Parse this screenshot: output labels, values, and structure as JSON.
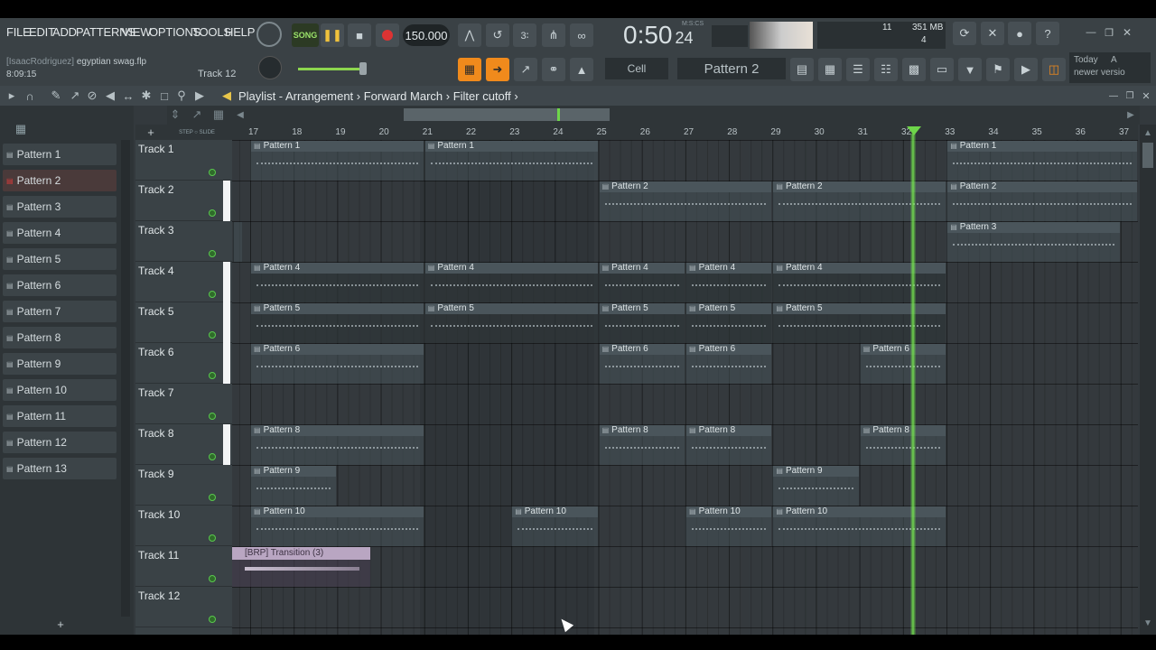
{
  "menu": [
    "FILE",
    "EDIT",
    "ADD",
    "PATTERNS",
    "VIEW",
    "OPTIONS",
    "TOOLS",
    "HELP"
  ],
  "project": {
    "user": "[IsaacRodriguez]",
    "file": "egyptian swag.flp",
    "time": "8:09:15",
    "track": "Track 12"
  },
  "transport": {
    "mode": "SONG",
    "tempo": "150.000",
    "time": "0:50",
    "time_small": "24",
    "time_label": "M:S:CS"
  },
  "cpu": {
    "value": "11",
    "memory": "351 MB",
    "voices": "4"
  },
  "snap": "Cell",
  "pattern_selector": "Pattern 2",
  "news": {
    "line1": "Today",
    "line2": "A",
    "line3": "newer versio"
  },
  "breadcrumb": {
    "view": "Playlist - Arrangement",
    "arrangement": "Forward March",
    "automation": "Filter cutoff"
  },
  "patterns": [
    "Pattern 1",
    "Pattern 2",
    "Pattern 3",
    "Pattern 4",
    "Pattern 5",
    "Pattern 6",
    "Pattern 7",
    "Pattern 8",
    "Pattern 9",
    "Pattern 10",
    "Pattern 11",
    "Pattern 12",
    "Pattern 13"
  ],
  "selected_pattern": "Pattern 2",
  "tracks": [
    "Track 1",
    "Track 2",
    "Track 3",
    "Track 4",
    "Track 5",
    "Track 6",
    "Track 7",
    "Track 8",
    "Track 9",
    "Track 10",
    "Track 11",
    "Track 12"
  ],
  "ruler": [
    "17",
    "18",
    "19",
    "20",
    "21",
    "22",
    "23",
    "24",
    "25",
    "26",
    "27",
    "28",
    "29",
    "30",
    "31",
    "32",
    "33",
    "34",
    "35",
    "36",
    "37"
  ],
  "clips": {
    "t1": [
      "Pattern 1",
      "Pattern 1",
      "Pattern 1"
    ],
    "t2": [
      "Pattern 2",
      "Pattern 2",
      "Pattern 2"
    ],
    "t3": [
      "Pattern 3"
    ],
    "t4": [
      "Pattern 4",
      "Pattern 4",
      "Pattern 4",
      "Pattern 4",
      "Pattern 4"
    ],
    "t5": [
      "Pattern 5",
      "Pattern 5",
      "Pattern 5",
      "Pattern 5",
      "Pattern 5"
    ],
    "t6": [
      "Pattern 6",
      "Pattern 6",
      "Pattern 6",
      "Pattern 6"
    ],
    "t8": [
      "Pattern 8",
      "Pattern 8",
      "Pattern 8",
      "Pattern 8"
    ],
    "t9": [
      "Pattern 9",
      "Pattern 9"
    ],
    "t10": [
      "Pattern 10",
      "Pattern 10",
      "Pattern 10",
      "Pattern 10"
    ],
    "t11": [
      "[BRP] Transition (3)"
    ]
  },
  "colors": {
    "accent": "#f08a1c",
    "playhead": "#6ed64a",
    "selected": "#d63b3b"
  }
}
